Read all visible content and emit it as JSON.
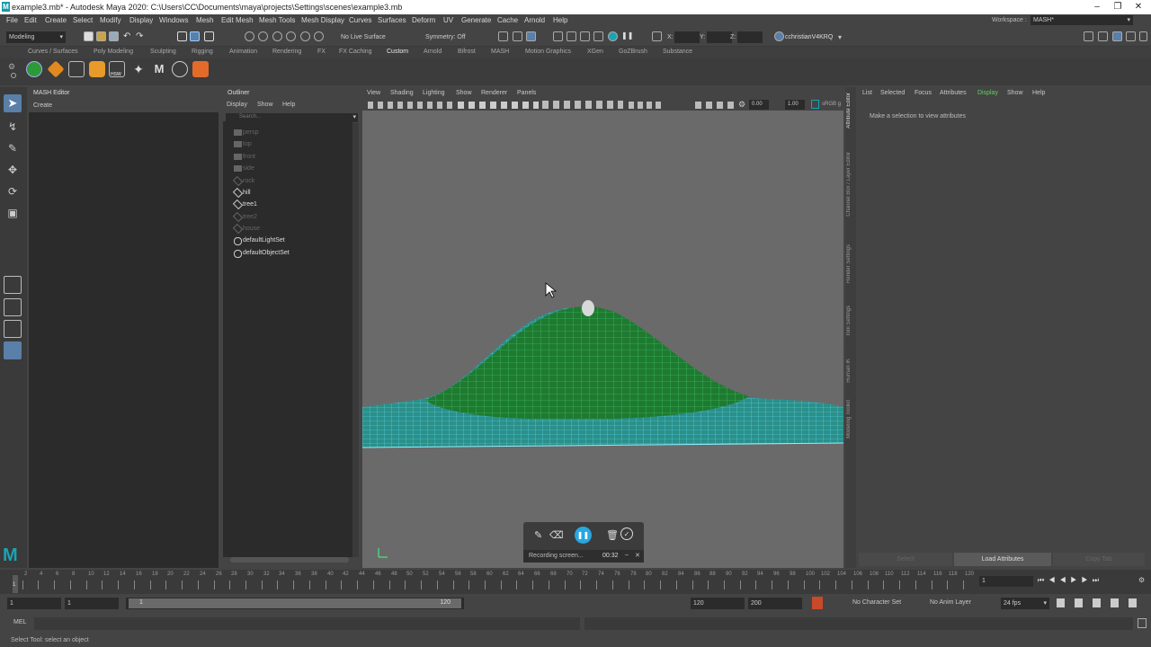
{
  "window": {
    "title": "example3.mb* - Autodesk Maya 2020: C:\\Users\\CC\\Documents\\maya\\projects\\Settings\\scenes\\example3.mb",
    "logo_letter": "M"
  },
  "menubar": [
    "File",
    "Edit",
    "Create",
    "Select",
    "Modify",
    "Display",
    "Windows",
    "Mesh",
    "Edit Mesh",
    "Mesh Tools",
    "Mesh Display",
    "Curves",
    "Surfaces",
    "Deform",
    "UV",
    "Generate",
    "Cache",
    "Arnold",
    "Help"
  ],
  "workspace": {
    "label": "Workspace :",
    "value": "MASH*"
  },
  "statusline": {
    "mode": "Modeling",
    "live_surface": "No Live Surface",
    "symmetry": "Symmetry: Off",
    "x_label": "X:",
    "y_label": "Y:",
    "z_label": "Z:",
    "user": "cchristianV4KRQ"
  },
  "shelf_tabs": [
    "Curves / Surfaces",
    "Poly Modeling",
    "Sculpting",
    "Rigging",
    "Animation",
    "Rendering",
    "FX",
    "FX Caching",
    "Custom",
    "Arnold",
    "Bifrost",
    "MASH",
    "Motion Graphics",
    "XGen",
    "GoZBrush",
    "Substance"
  ],
  "shelf_active": "Custom",
  "shelf_hsw": "HSW",
  "mash_editor": {
    "title": "MASH Editor",
    "menu": "Create"
  },
  "outliner": {
    "title": "Outliner",
    "menu": [
      "Display",
      "Show",
      "Help"
    ],
    "search_placeholder": "Search...",
    "items": [
      "persp",
      "top",
      "front",
      "side",
      "rock",
      "hill",
      "tree1",
      "tree2",
      "house",
      "defaultLightSet",
      "defaultObjectSet"
    ]
  },
  "viewport": {
    "menu": [
      "View",
      "Shading",
      "Lighting",
      "Show",
      "Renderer",
      "Panels"
    ],
    "value1": "0.00",
    "value2": "1.00",
    "colorspace": "sRGB g"
  },
  "attribute_editor": {
    "menu": [
      "List",
      "Selected",
      "Focus",
      "Attributes",
      "Display",
      "Show",
      "Help"
    ],
    "active_menu": "Display",
    "message": "Make a selection to view attributes",
    "buttons": {
      "select": "Select",
      "load": "Load Attributes",
      "copy": "Copy Tab"
    }
  },
  "side_tabs": [
    "Attribute Editor",
    "Channel Box / Layer Editor",
    "Render Settings",
    "Tool Settings",
    "Human IK",
    "Modeling Toolkit"
  ],
  "recording": {
    "text": "Recording screen...",
    "time": "00:32"
  },
  "timeline": {
    "ticks": [
      "2",
      "4",
      "6",
      "8",
      "10",
      "12",
      "14",
      "16",
      "18",
      "20",
      "22",
      "24",
      "26",
      "28",
      "30",
      "32",
      "34",
      "36",
      "38",
      "40",
      "42",
      "44",
      "46",
      "48",
      "50",
      "52",
      "54",
      "56",
      "58",
      "60",
      "62",
      "64",
      "66",
      "68",
      "70",
      "72",
      "74",
      "76",
      "78",
      "80",
      "82",
      "84",
      "86",
      "88",
      "90",
      "92",
      "94",
      "96",
      "98",
      "100",
      "102",
      "104",
      "106",
      "108",
      "110",
      "112",
      "114",
      "116",
      "118",
      "120"
    ],
    "current_frame": "1",
    "current_frame_field": "1"
  },
  "range": {
    "start": "1",
    "start2": "1",
    "slider_start": "1",
    "slider_end": "120",
    "end": "120",
    "end2": "200",
    "character_set": "No Character Set",
    "anim_layer": "No Anim Layer",
    "fps": "24 fps"
  },
  "cmdline": {
    "label": "MEL"
  },
  "helpline": {
    "text": "Select Tool: select an object"
  },
  "colors": {
    "mesh_green": "#1e7a2e",
    "mesh_cyan": "#5fe0f0",
    "accent_teal": "#1aa3b5"
  }
}
